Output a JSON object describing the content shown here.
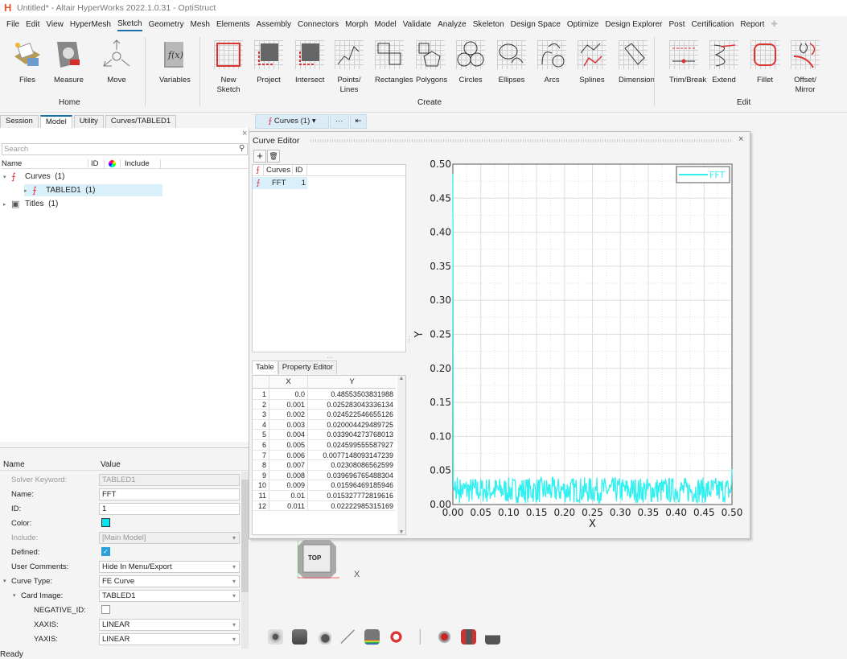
{
  "window": {
    "title": "Untitled* - Altair HyperWorks 2022.1.0.31 - OptiStruct"
  },
  "menu": [
    "File",
    "Edit",
    "View",
    "HyperMesh",
    "Sketch",
    "Geometry",
    "Mesh",
    "Elements",
    "Assembly",
    "Connectors",
    "Morph",
    "Model",
    "Validate",
    "Analyze",
    "Skeleton",
    "Design Space",
    "Optimize",
    "Design Explorer",
    "Post",
    "Certification",
    "Report"
  ],
  "menu_active": "Sketch",
  "ribbon": {
    "home": {
      "label": "Home",
      "buttons": [
        "Files",
        "Measure",
        "Move"
      ]
    },
    "variables": "Variables",
    "create": {
      "label": "Create",
      "buttons": [
        "New Sketch",
        "Project",
        "Intersect",
        "Points/ Lines",
        "Rectangles",
        "Polygons",
        "Circles",
        "Ellipses",
        "Arcs",
        "Splines",
        "Dimension"
      ]
    },
    "edit": {
      "label": "Edit",
      "buttons": [
        "Trim/Break",
        "Extend",
        "Fillet",
        "Offset/ Mirror"
      ]
    }
  },
  "panel_tabs": [
    "Session",
    "Model",
    "Utility",
    "Curves/TABLED1"
  ],
  "browser": {
    "search_placeholder": "Search",
    "columns": [
      "Name",
      "ID",
      "",
      "Include"
    ],
    "tree": [
      {
        "label": "Curves  (1)",
        "level": 0,
        "expanded": true
      },
      {
        "label": "TABLED1  (1)",
        "level": 1,
        "selected": true
      },
      {
        "label": "Titles  (1)",
        "level": 0
      }
    ]
  },
  "properties": {
    "columns": [
      "Name",
      "Value"
    ],
    "rows": [
      {
        "name": "Solver Keyword:",
        "value": "TABLED1",
        "disabled": true
      },
      {
        "name": "Name:",
        "value": "FFT"
      },
      {
        "name": "ID:",
        "value": "1"
      },
      {
        "name": "Color:",
        "value": "#00e5ee",
        "type": "color"
      },
      {
        "name": "Include:",
        "value": "[Main Model]",
        "disabled": true,
        "type": "dropdown"
      },
      {
        "name": "Defined:",
        "value": "true",
        "type": "checkbox"
      },
      {
        "name": "User Comments:",
        "value": "Hide In Menu/Export",
        "type": "dropdown"
      },
      {
        "name": "Curve Type:",
        "value": "FE Curve",
        "type": "dropdown"
      },
      {
        "name": "Card Image:",
        "value": "TABLED1",
        "type": "dropdown"
      },
      {
        "name": "NEGATIVE_ID:",
        "value": "false",
        "type": "checkbox"
      },
      {
        "name": "XAXIS:",
        "value": "LINEAR",
        "type": "dropdown"
      },
      {
        "name": "YAXIS:",
        "value": "LINEAR",
        "type": "dropdown"
      }
    ]
  },
  "view_toolbar": {
    "curves": "Curves (1)",
    "more": "···",
    "first": "⏮"
  },
  "curve_editor": {
    "title": "Curve Editor",
    "add": "+",
    "delete": "🗑",
    "list_columns": [
      "Curves",
      "ID"
    ],
    "list": [
      {
        "name": "FFT",
        "id": "1"
      }
    ],
    "tabs": [
      "Table",
      "Property Editor"
    ],
    "table_columns": [
      "",
      "X",
      "Y"
    ],
    "table_rows": [
      [
        "1",
        "0.0",
        "0.48553503831988"
      ],
      [
        "2",
        "0.001",
        "0.025283043336134"
      ],
      [
        "3",
        "0.002",
        "0.024522546655126"
      ],
      [
        "4",
        "0.003",
        "0.020004429489725"
      ],
      [
        "5",
        "0.004",
        "0.033904273768013"
      ],
      [
        "6",
        "0.005",
        "0.024599555587927"
      ],
      [
        "7",
        "0.006",
        "0.0077148093147239"
      ],
      [
        "8",
        "0.007",
        "0.02308086562599"
      ],
      [
        "9",
        "0.008",
        "0.039696765488304"
      ],
      [
        "10",
        "0.009",
        "0.01596469185946"
      ],
      [
        "11",
        "0.01",
        "0.015327772819616"
      ],
      [
        "12",
        "0.011",
        "0.02222985315169"
      ]
    ]
  },
  "chart_data": {
    "type": "line",
    "title": "",
    "xlabel": "X",
    "ylabel": "Y",
    "xlim": [
      0,
      0.5
    ],
    "ylim": [
      0,
      0.5
    ],
    "xticks": [
      "0.00",
      "0.05",
      "0.10",
      "0.15",
      "0.20",
      "0.25",
      "0.30",
      "0.35",
      "0.40",
      "0.45",
      "0.50"
    ],
    "yticks": [
      "0.00",
      "0.05",
      "0.10",
      "0.15",
      "0.20",
      "0.25",
      "0.30",
      "0.35",
      "0.40",
      "0.45",
      "0.50"
    ],
    "grid": true,
    "legend": {
      "position": "top-right",
      "entries": [
        "FFT"
      ]
    },
    "series": [
      {
        "name": "FFT",
        "color": "#33f0f0",
        "x_start": 0.0,
        "x_step": 0.001,
        "first_values": [
          0.48553503831988,
          0.025283043336134,
          0.024522546655126,
          0.020004429489725,
          0.033904273768013,
          0.024599555587927,
          0.0077148093147239,
          0.02308086562599,
          0.039696765488304,
          0.01596469185946,
          0.015327772819616,
          0.02222985315169
        ],
        "noise_range": [
          0.002,
          0.04
        ],
        "last_value": 0.052
      }
    ]
  },
  "viewcube": {
    "label": "TOP",
    "axis": "X"
  },
  "status": "Ready"
}
